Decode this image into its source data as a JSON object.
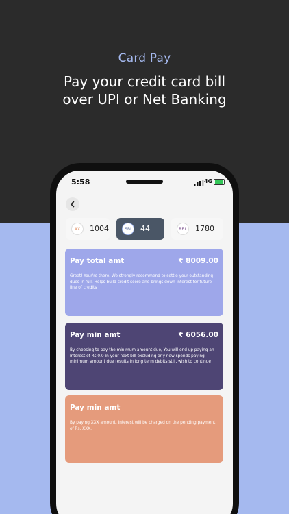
{
  "promo": {
    "kicker": "Card Pay",
    "headline_line1": "Pay your credit card bill",
    "headline_line2": "over UPI or Net Banking"
  },
  "status_bar": {
    "time": "5:58",
    "network": "4G"
  },
  "cards": [
    {
      "bank": "AX",
      "amount": "1004",
      "logo_color": "#e08a5c"
    },
    {
      "bank": "SBI",
      "amount": "44",
      "logo_color": "#5a6c9c"
    },
    {
      "bank": "RBL",
      "amount": "1780",
      "logo_color": "#7a4f8c"
    }
  ],
  "options": [
    {
      "title": "Pay total amt",
      "amount": "₹ 8009.00",
      "description": "Great! Your're there. We strongly recommend to settle your outstanding dues in full. Helps build credit score and brings down interest for future line of credits"
    },
    {
      "title": "Pay min amt",
      "amount": "₹ 6056.00",
      "description": "By choosing to pay the minimum amount due, You will end up paying an interest of Rs 0.0 in your next bill excluding any new spends paying minimum amount due results in long term debits still, wish to continue"
    },
    {
      "title": "Pay min amt",
      "amount": "",
      "description": "By paying XXX amount, Interest will be charged on the pending payment of Rs. XXX."
    }
  ],
  "colors": {
    "top_bg": "#2b2b2b",
    "bottom_bg": "#a5b9ef",
    "option_total": "#9ea7ea",
    "option_min": "#4e4574",
    "option_custom": "#e59b7c",
    "active_card": "#4a5666"
  }
}
